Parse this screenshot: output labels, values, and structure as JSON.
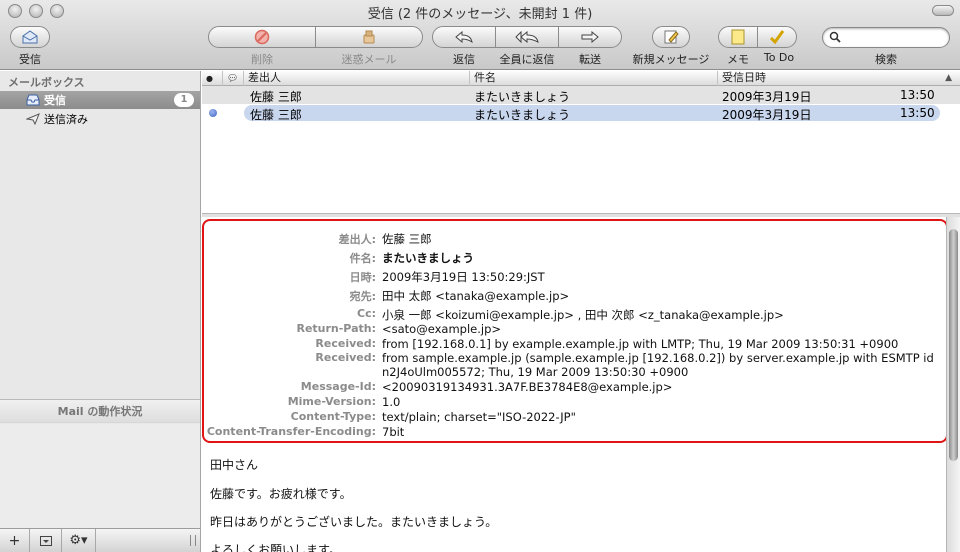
{
  "window": {
    "title": "受信 (2 件のメッセージ、未開封 1 件)"
  },
  "toolbar": {
    "inbox_label": "受信",
    "delete_label": "削除",
    "junk_label": "迷惑メール",
    "reply_label": "返信",
    "reply_all_label": "全員に返信",
    "forward_label": "転送",
    "new_message_label": "新規メッセージ",
    "note_label": "メモ",
    "todo_label": "To Do",
    "search_label": "検索",
    "search_placeholder": ""
  },
  "sidebar": {
    "heading": "メールボックス",
    "items": [
      {
        "label": "受信",
        "badge": "1",
        "icon": "inbox-icon"
      },
      {
        "label": "送信済み",
        "icon": "sent-icon"
      }
    ],
    "activity_title": "Mail の動作状況"
  },
  "message_list": {
    "columns": [
      "差出人",
      "件名",
      "受信日時"
    ],
    "rows": [
      {
        "from": "佐藤 三郎",
        "subject": "またいきましょう",
        "date": "2009年3月19日",
        "time": "13:50",
        "unread": false
      },
      {
        "from": "佐藤 三郎",
        "subject": "またいきましょう",
        "date": "2009年3月19日",
        "time": "13:50",
        "unread": true
      }
    ]
  },
  "message": {
    "headers": [
      {
        "label": "差出人:",
        "value": "佐藤 三郎"
      },
      {
        "label": "件名:",
        "value": "またいきましょう"
      },
      {
        "label": "日時:",
        "value": "2009年3月19日 13:50:29:JST"
      },
      {
        "label": "宛先:",
        "value": "田中 太郎 <tanaka@example.jp>"
      },
      {
        "label": "Cc:",
        "value": "小泉 一郎 <koizumi@example.jp> ,  田中 次郎 <z_tanaka@example.jp>"
      },
      {
        "label": "Return-Path:",
        "value": "<sato@example.jp>"
      },
      {
        "label": "Received:",
        "value": "from [192.168.0.1] by example.example.jp with LMTP; Thu, 19 Mar 2009 13:50:31 +0900"
      },
      {
        "label": "Received:",
        "value": "from sample.example.jp (sample.example.jp [192.168.0.2]) by server.example.jp with ESMTP id",
        "value2": "n2J4oUlm005572; Thu, 19 Mar 2009 13:50:30 +0900"
      },
      {
        "label": "Message-Id:",
        "value": "<20090319134931.3A7F.BE3784E8@example.jp>"
      },
      {
        "label": "Mime-Version:",
        "value": "1.0"
      },
      {
        "label": "Content-Type:",
        "value": "text/plain; charset=\"ISO-2022-JP\""
      },
      {
        "label": "Content-Transfer-Encoding:",
        "value": "7bit"
      }
    ],
    "body": [
      "田中さん",
      "佐藤です。お疲れ様です。",
      "昨日はありがとうございました。またいきましょう。",
      "よろしくお願いします。"
    ]
  },
  "colors": {
    "highlight_border": "#e01414",
    "selection": "#c8d6ee",
    "unread_dot": "#3e63c7"
  }
}
